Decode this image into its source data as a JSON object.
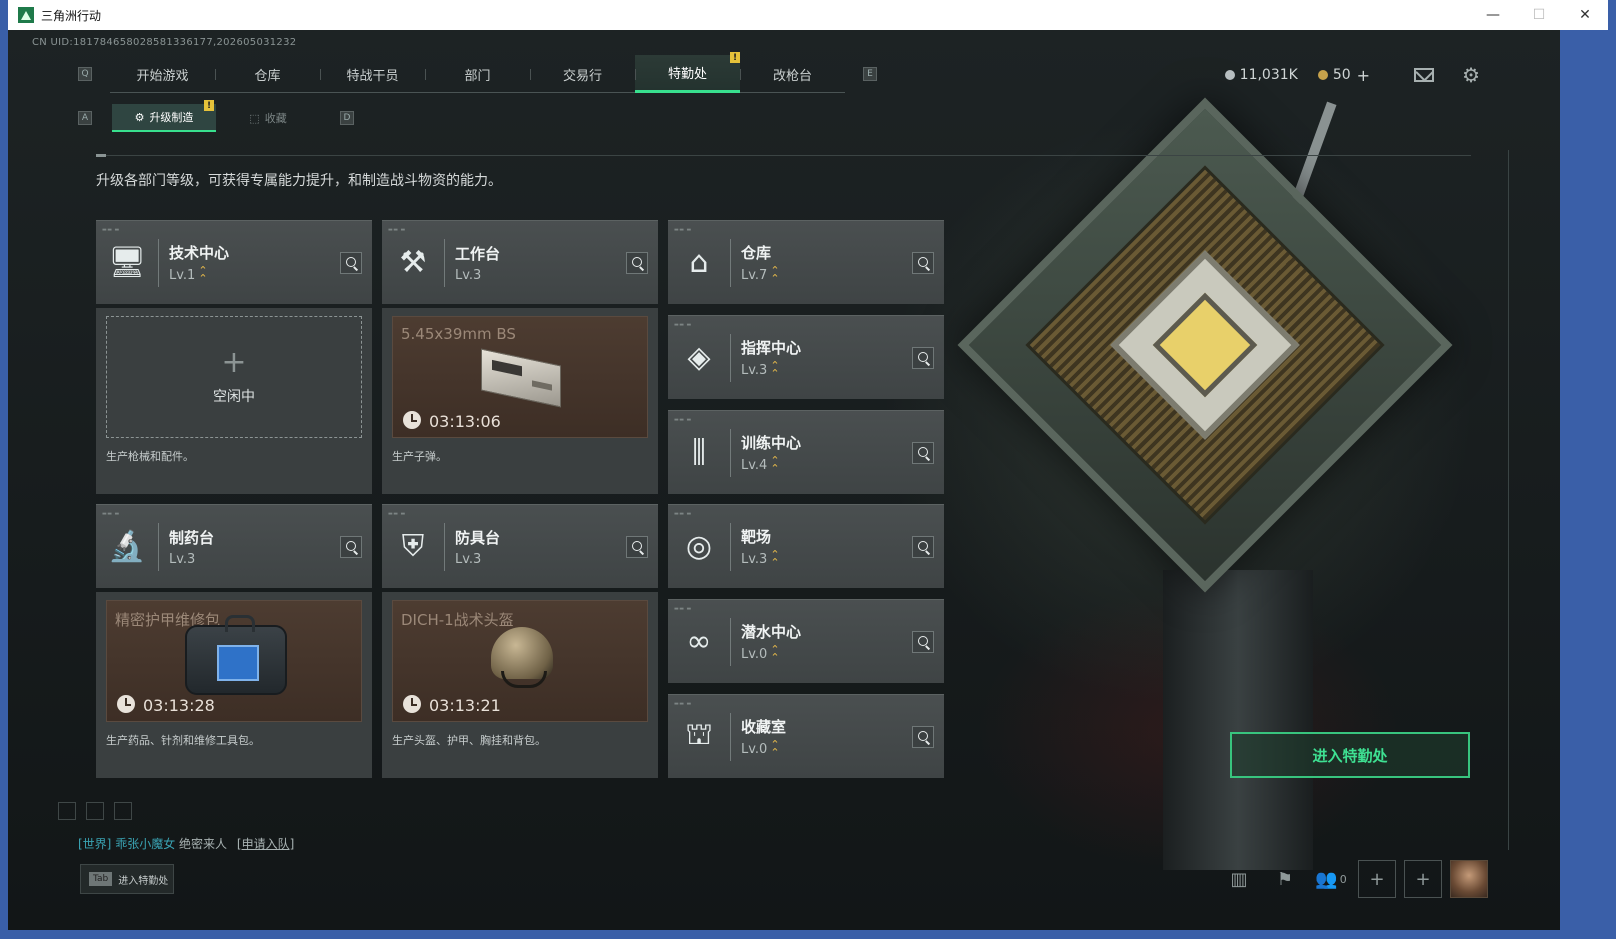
{
  "window": {
    "title": "三角洲行动"
  },
  "uid": "CN UID:181784658028581336177,202605031232",
  "keys": {
    "left_tab": "Q",
    "right_tab": "E",
    "left_sub": "A",
    "right_sub": "D"
  },
  "tabs": [
    {
      "label": "开始游戏",
      "active": false
    },
    {
      "label": "仓库",
      "active": false
    },
    {
      "label": "特战干员",
      "active": false
    },
    {
      "label": "部门",
      "active": false
    },
    {
      "label": "交易行",
      "active": false
    },
    {
      "label": "特勤处",
      "active": true,
      "badge": "!"
    },
    {
      "label": "改枪台",
      "active": false
    }
  ],
  "subtabs": [
    {
      "label": "升级制造",
      "active": true,
      "badge": "!"
    },
    {
      "label": "收藏",
      "active": false
    }
  ],
  "currency": {
    "silver": "11,031K",
    "gold": "50",
    "plus": "+"
  },
  "description": "升级各部门等级，可获得专属能力提升，和制造战斗物资的能力。",
  "facilities": {
    "tech": {
      "name": "技术中心",
      "level": "Lv.1",
      "upgradable": true,
      "icon": "monitor-icon"
    },
    "workbench": {
      "name": "工作台",
      "level": "Lv.3",
      "upgradable": false,
      "icon": "hammer-wrench-icon"
    },
    "warehouse": {
      "name": "仓库",
      "level": "Lv.7",
      "upgradable": true,
      "icon": "warehouse-icon"
    },
    "command": {
      "name": "指挥中心",
      "level": "Lv.3",
      "upgradable": true,
      "icon": "command-diamond-icon"
    },
    "training": {
      "name": "训练中心",
      "level": "Lv.4",
      "upgradable": true,
      "icon": "dumbbell-icon"
    },
    "pharmacy": {
      "name": "制药台",
      "level": "Lv.3",
      "upgradable": false,
      "icon": "microscope-icon"
    },
    "armor": {
      "name": "防具台",
      "level": "Lv.3",
      "upgradable": false,
      "icon": "armor-icon"
    },
    "range": {
      "name": "靶场",
      "level": "Lv.3",
      "upgradable": true,
      "icon": "target-icon"
    },
    "diving": {
      "name": "潜水中心",
      "level": "Lv.0",
      "upgradable": true,
      "icon": "goggles-icon"
    },
    "collection": {
      "name": "收藏室",
      "level": "Lv.0",
      "upgradable": true,
      "icon": "trophy-case-icon"
    }
  },
  "production": {
    "tech": {
      "idle": true,
      "idle_label": "空闲中",
      "desc": "生产枪械和配件。"
    },
    "workbench": {
      "item": "5.45x39mm BS",
      "time": "03:13:06",
      "desc": "生产子弹。"
    },
    "pharmacy": {
      "item": "精密护甲维修包",
      "time": "03:13:28",
      "desc": "生产药品、针剂和维修工具包。"
    },
    "armor": {
      "item": "DICH-1战术头盔",
      "time": "03:13:21",
      "desc": "生产头盔、护甲、胸挂和背包。"
    }
  },
  "enter_button": "进入特勤处",
  "chat": {
    "channel": "[世界]",
    "user": "乖张小魔女",
    "message": "绝密来人",
    "link": "[申请入队]"
  },
  "tab_hint": {
    "key": "Tab",
    "label": "进入特勤处"
  },
  "social": {
    "friends_count": "0"
  },
  "colors": {
    "accent": "#38e08e",
    "badge": "#e6c23a",
    "upgrade": "#e4b74a"
  }
}
